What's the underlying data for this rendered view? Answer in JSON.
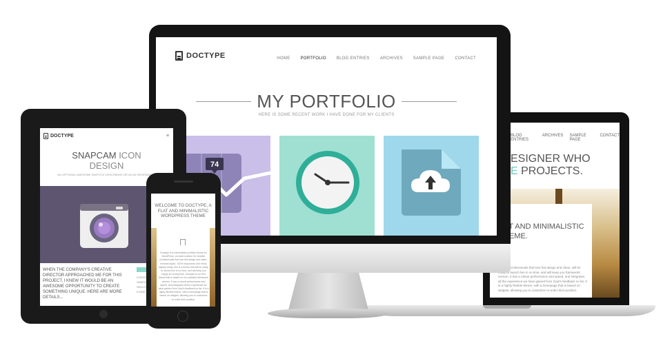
{
  "colors": {
    "accent_teal": "#6cc9c0",
    "tile_purple": "#c9bfe8",
    "tile_mint": "#9fe0d2",
    "tile_sky": "#9fd8ea",
    "device_black": "#141414"
  },
  "monitor": {
    "logo": "DOCTYPE",
    "nav": [
      "HOME",
      "PORTFOLIO",
      "BLOG ENTRIES",
      "ARCHIVES",
      "SAMPLE PAGE",
      "CONTACT"
    ],
    "title": "MY PORTFOLIO",
    "subtitle": "HERE IS SOME RECENT WORK I HAVE DONE FOR MY CLIENTS",
    "tiles": [
      {
        "icon": "line-chart-icon",
        "value": "74"
      },
      {
        "icon": "clock-icon"
      },
      {
        "icon": "cloud-upload-icon"
      }
    ]
  },
  "laptop": {
    "nav": [
      "BLOG ENTRIES",
      "ARCHIVES",
      "SAMPLE PAGE",
      "CONTACT"
    ],
    "heading_line1": "ESIGNER WHO",
    "heading_line2_accent": "E",
    "heading_line2_rest": " PROJECTS.",
    "card_title": "ST AND MINIMALISTIC HEME.",
    "card_text": "creative professionals that love flat design and clean. will be ready to launch live in no time, and will keep you framework version. It has a robust performance and speed, and integrates all the experience we have gained from Gopi's feedback so far. It is a highly flexible theme, with a homepage that is based on widgets, allowing you to customize re-order their position."
  },
  "tablet": {
    "logo": "DOCTYPE",
    "menu_icon": "hamburger-icon",
    "title_line1_a": "SNAPCAM",
    "title_line1_b": " ICON",
    "title_line2": "DESIGN",
    "subtitle": "AN OPTIONAL AWESOME SUBTITLE DESCRIBING OR AS AN INFORMATIVE",
    "body_text": "WHEN THE COMPANY'S CREATIVE DIRECTOR APPROACHED ME FOR THIS PROJECT, I KNEW IT WOULD BE AN AWESOME OPPORTUNITY TO CREATE SOMETHING UNIQUE. HERE ARE MORE DETAILS...",
    "side_lines": [
      "CLIENT",
      "SNAPCAM",
      "",
      "SKILLS",
      "ICONS"
    ]
  },
  "phone": {
    "title": "WELCOME TO DOCTYPE, A FLAT AND MINIMALISTIC WORDPRESS THEME",
    "body_text": "Doctype is a minimalistic portfolio theme for WordPress, an ideal solution for creative professionals that love flat design and clean, minimal styles. 100% responsive and retina display ready, this is a theme that will be ready to launch live in no time, and will keep you happy for a long time. Doctype is our first theme that is based on our updated framework version. It has a robust performance and speed, and integrates all the experience we have gained from Gopi's feedback so far. It is a highly flexible theme, with a homepage that is based on widgets, allowing you to customize re-order their position."
  }
}
